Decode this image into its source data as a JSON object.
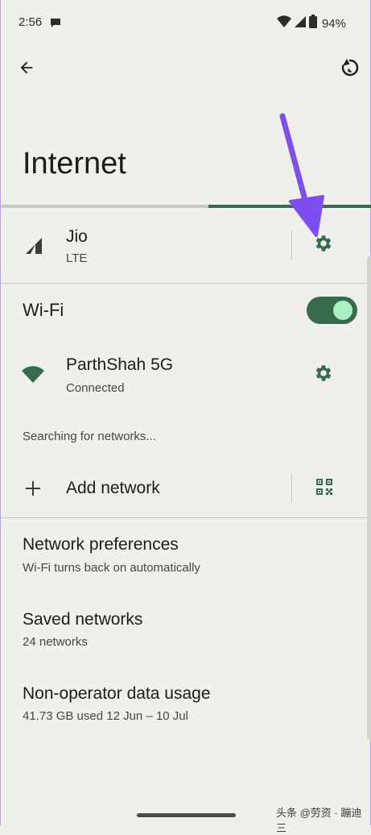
{
  "status_bar": {
    "time": "2:56",
    "battery": "94%"
  },
  "header": {
    "title": "Internet"
  },
  "loading_progress": 0.44,
  "mobile": {
    "carrier": "Jio",
    "type": "LTE"
  },
  "wifi": {
    "label": "Wi-Fi",
    "enabled": true,
    "connected_network": {
      "name": "ParthShah 5G",
      "status": "Connected"
    },
    "searching_text": "Searching for networks...",
    "add_network_label": "Add network"
  },
  "menu": {
    "items": [
      {
        "title": "Network preferences",
        "subtitle": "Wi-Fi turns back on automatically"
      },
      {
        "title": "Saved networks",
        "subtitle": "24 networks"
      },
      {
        "title": "Non-operator data usage",
        "subtitle": "41.73 GB used 12 Jun – 10 Jul"
      }
    ]
  },
  "watermark": "头条 @劳资 · 蹦迪三",
  "colors": {
    "accent": "#386a4d",
    "toggle_knob": "#a8f0c3",
    "annotation_arrow": "#7d4ef0",
    "background": "#eff0eb"
  },
  "icons": {
    "back": "arrow-left-icon",
    "refresh": "refresh-icon",
    "signal": "signal-icon",
    "settings": "gear-icon",
    "wifi": "wifi-icon",
    "add": "plus-icon",
    "qr": "qr-code-icon"
  }
}
